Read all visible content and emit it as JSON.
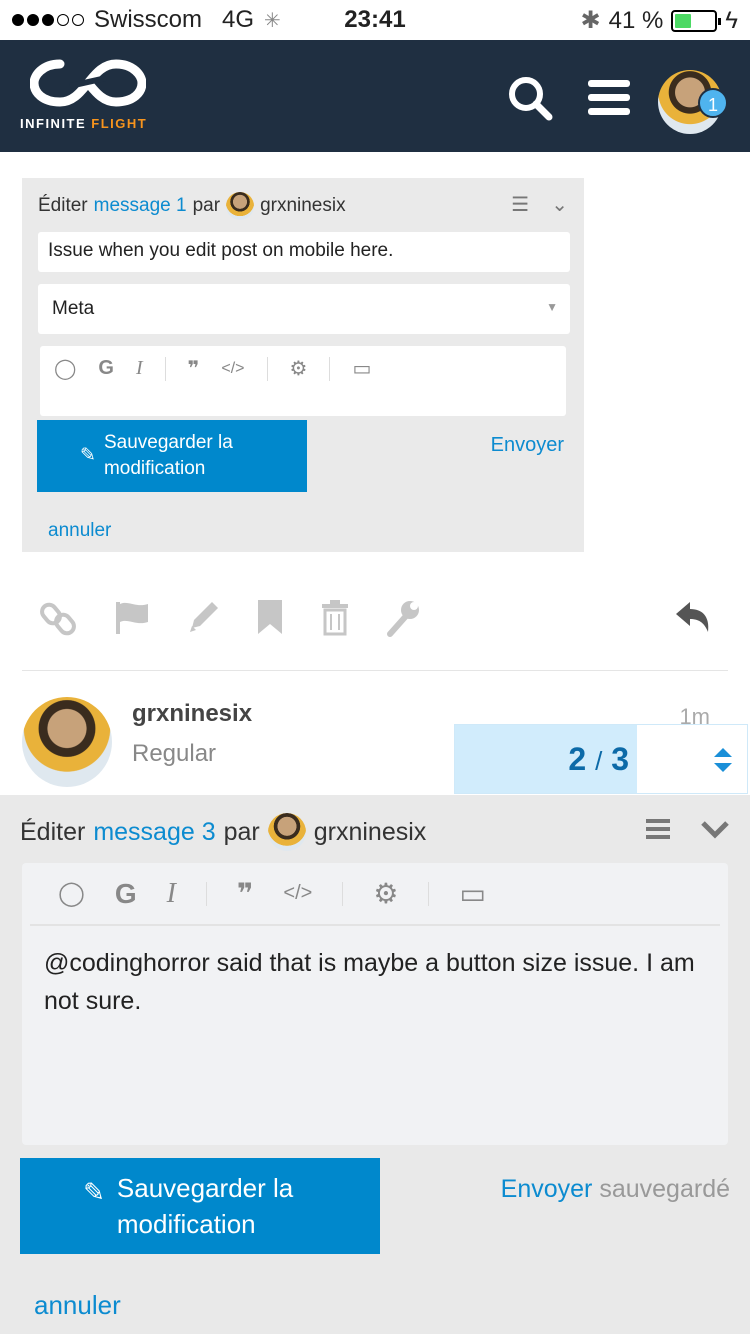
{
  "status_bar": {
    "carrier": "Swisscom",
    "network": "4G",
    "time": "23:41",
    "battery_percent": "41 %",
    "battery_level": 0.41
  },
  "header": {
    "brand_part1": "INFINITE ",
    "brand_part2": "FLIGHT",
    "notification_count": "1",
    "colors": {
      "bg": "#1f2f41",
      "accent": "#f7941d",
      "badge": "#4fb4ef"
    }
  },
  "embedded_edit": {
    "prefix": "Éditer",
    "message_link": "message 1",
    "by": "par",
    "username": "grxninesix",
    "title_value": "Issue when you edit post on mobile here.",
    "category": "Meta",
    "save_label": "Sauvegarder la modification",
    "send_label": "Envoyer",
    "cancel_label": "annuler"
  },
  "post": {
    "username": "grxninesix",
    "user_group": "Regular",
    "age": "1m"
  },
  "progress": {
    "current": "2",
    "separator": "/",
    "total": "3"
  },
  "composer": {
    "prefix": "Éditer",
    "message_link": "message 3",
    "by": "par",
    "username": "grxninesix",
    "body": "@codinghorror said that is maybe a button size issue. I am not sure.",
    "save_label": "Sauvegarder la modification",
    "send_label": "Envoyer",
    "saved_label": "sauvegardé",
    "cancel_label": "annuler"
  }
}
